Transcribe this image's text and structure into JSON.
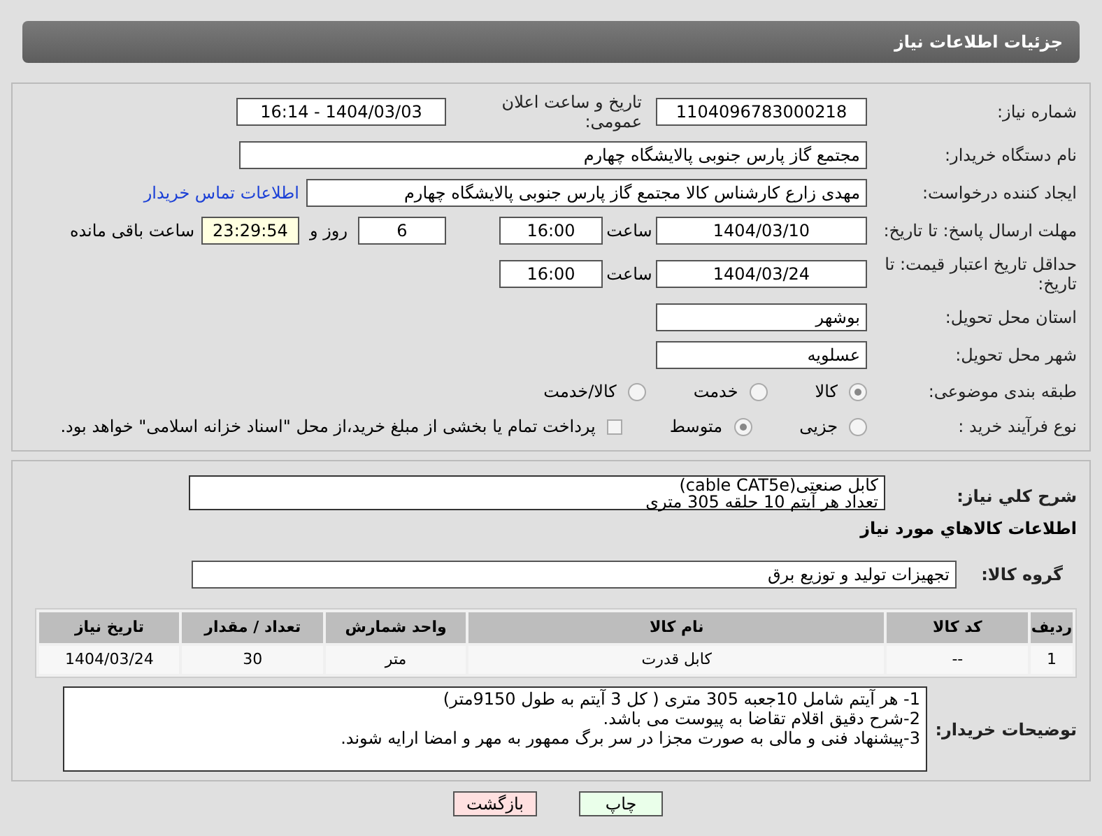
{
  "title": "جزئیات اطلاعات نیاز",
  "need_number": {
    "label": "شماره نیاز:",
    "value": "1104096783000218"
  },
  "announce": {
    "label": "تاریخ و ساعت اعلان عمومی:",
    "value": "1404/03/03 - 16:14"
  },
  "buyer": {
    "label": "نام دستگاه خریدار:",
    "value": "مجتمع گاز پارس جنوبی  پالایشگاه چهارم"
  },
  "creator": {
    "label": "ایجاد کننده درخواست:",
    "value": "مهدی زارع کارشناس کالا مجتمع گاز پارس جنوبی  پالایشگاه چهارم",
    "link": "اطلاعات تماس خریدار"
  },
  "deadline": {
    "label": "مهلت ارسال پاسخ: تا تاریخ:",
    "date": "1404/03/10",
    "time_label": "ساعت",
    "time": "16:00",
    "days": "6",
    "days_label": "روز و",
    "remaining": "23:29:54",
    "remaining_label": "ساعت باقی مانده"
  },
  "validity": {
    "label": "حداقل تاریخ اعتبار قیمت: تا تاریخ:",
    "date": "1404/03/24",
    "time_label": "ساعت",
    "time": "16:00"
  },
  "province": {
    "label": "استان محل تحویل:",
    "value": "بوشهر"
  },
  "city": {
    "label": "شهر محل تحویل:",
    "value": "عسلویه"
  },
  "category": {
    "label": "طبقه بندی موضوعی:",
    "options": [
      {
        "label": "کالا",
        "selected": true
      },
      {
        "label": "خدمت",
        "selected": false
      },
      {
        "label": "کالا/خدمت",
        "selected": false
      }
    ]
  },
  "process": {
    "label": "نوع فرآیند خرید :",
    "options": [
      {
        "label": "جزیی",
        "selected": false
      },
      {
        "label": "متوسط",
        "selected": true
      }
    ],
    "payment": {
      "label": "پرداخت تمام یا بخشی از مبلغ خرید،از محل \"اسناد خزانه اسلامی\" خواهد بود.",
      "checked": false
    }
  },
  "description": {
    "label": "شرح کلي نياز:",
    "lines": [
      "کابل صنعتی(cable CAT5e)",
      "تعداد هر آیتم 10 حلقه 305 متری"
    ]
  },
  "goods_heading": "اطلاعات کالاهاي مورد نياز",
  "group": {
    "label": "گروه کالا:",
    "value": "تجهیزات تولید و توزیع برق"
  },
  "table": {
    "columns": [
      "ردیف",
      "کد کالا",
      "نام کالا",
      "واحد شمارش",
      "تعداد / مقدار",
      "تاریخ نیاز"
    ],
    "rows": [
      [
        "1",
        "--",
        "کابل قدرت",
        "متر",
        "30",
        "1404/03/24"
      ]
    ]
  },
  "notes": {
    "label": "توضیحات خریدار:",
    "lines": [
      "1- هر آیتم شامل 10جعبه 305 متری  ( کل 3 آیتم به طول 9150متر)",
      "2-شرح دقیق اقلام تقاضا به پیوست می باشد.",
      "3-پیشنهاد فنی و مالی به صورت مجزا در سر برگ ممهور به مهر و امضا ارایه شوند."
    ]
  },
  "buttons": [
    {
      "label": "چاپ",
      "kind": "print"
    },
    {
      "label": "بازگشت",
      "kind": "back"
    }
  ]
}
